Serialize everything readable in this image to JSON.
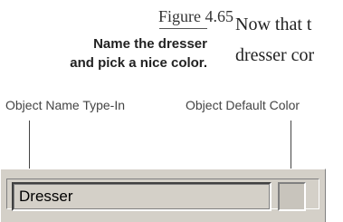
{
  "figure": {
    "label": "Figure 4.65",
    "caption_line1": "Name the dresser",
    "caption_line2": "and pick a nice color."
  },
  "body_text": {
    "line1": "Now that t",
    "line2": "dresser cor"
  },
  "callouts": {
    "name_label": "Object Name Type-In",
    "color_label": "Object Default Color"
  },
  "panel": {
    "object_name_value": "Dresser",
    "default_color": "#c8c4bc"
  }
}
